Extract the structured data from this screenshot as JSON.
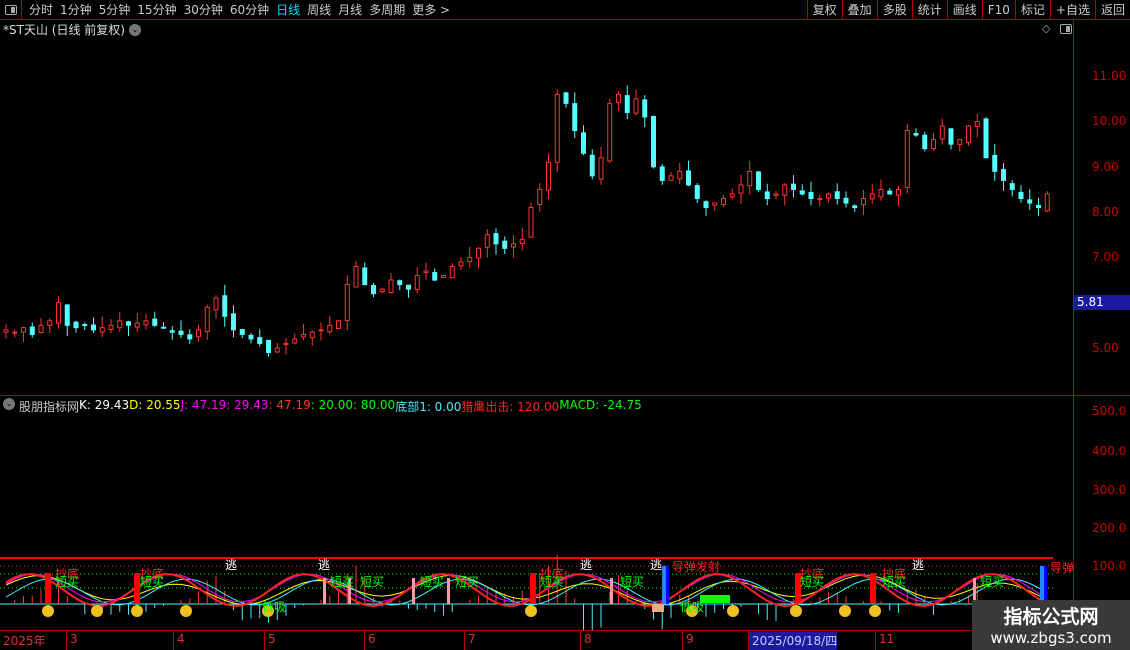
{
  "toolbar": {
    "periods": [
      "分时",
      "1分钟",
      "5分钟",
      "15分钟",
      "30分钟",
      "60分钟",
      "日线",
      "周线",
      "月线",
      "多周期",
      "更多 >"
    ],
    "active": "日线",
    "right_buttons": [
      "复权",
      "叠加",
      "多股",
      "统计",
      "画线",
      "F10",
      "标记",
      "+自选",
      "返回"
    ]
  },
  "stock": {
    "title": "*ST天山 (日线 前复权)"
  },
  "price_axis": {
    "labels": [
      "11.00",
      "10.00",
      "9.00",
      "8.00",
      "7.00",
      "5.00"
    ],
    "current": "5.81",
    "current_bg": "#1a1aa0"
  },
  "indicator": {
    "name": "股朋指标网",
    "k": "K: 29.43",
    "d": "D: 20.55",
    "j": "J: 47.19",
    "v1": ": 29.43",
    "v2": ": 47.19",
    "v3": ": 20.00",
    "v4": ": 80.00",
    "bottom": "底部1: 0.00",
    "eagle": "猎鹰出击: 120.00",
    "macd": "MACD: -24.75",
    "axis": [
      "500.0",
      "400.0",
      "300.0",
      "200.0",
      "100.0"
    ]
  },
  "signals": {
    "chaodi": "抄底",
    "duanmai": "短买",
    "tao": "逃",
    "dixi": "低吸",
    "daodan_fashe": "导弹发射",
    "daodan": "导弹"
  },
  "dates": [
    "2025年",
    "3",
    "4",
    "5",
    "6",
    "7",
    "8",
    "9",
    "2025/09/18/四",
    "11"
  ],
  "watermark": {
    "name": "指标公式网",
    "url": "www.zbgs3.com"
  },
  "chart_data": {
    "type": "candlestick",
    "ylim": [
      4.2,
      12
    ],
    "closes": [
      5.4,
      5.35,
      5.45,
      5.3,
      5.5,
      5.6,
      6.0,
      5.5,
      5.45,
      5.5,
      5.4,
      5.45,
      5.5,
      5.6,
      5.5,
      5.55,
      5.6,
      5.5,
      5.45,
      5.35,
      5.3,
      5.2,
      5.4,
      5.9,
      6.1,
      5.7,
      5.4,
      5.3,
      5.2,
      5.1,
      4.9,
      5.0,
      5.1,
      5.2,
      5.3,
      5.35,
      5.4,
      5.5,
      5.6,
      6.4,
      6.8,
      6.4,
      6.2,
      6.3,
      6.5,
      6.4,
      6.3,
      6.6,
      6.7,
      6.5,
      6.6,
      6.8,
      6.9,
      7.0,
      7.2,
      7.5,
      7.3,
      7.2,
      7.3,
      7.4,
      8.1,
      8.5,
      9.1,
      10.6,
      10.4,
      9.8,
      9.3,
      8.8,
      9.2,
      10.4,
      10.6,
      10.2,
      10.5,
      10.1,
      9.0,
      8.7,
      8.8,
      8.9,
      8.6,
      8.3,
      8.1,
      8.2,
      8.3,
      8.4,
      8.6,
      8.9,
      8.5,
      8.3,
      8.4,
      8.6,
      8.5,
      8.4,
      8.3,
      8.3,
      8.4,
      8.3,
      8.2,
      8.1,
      8.3,
      8.4,
      8.5,
      8.4,
      8.5,
      9.8,
      9.7,
      9.4,
      9.6,
      9.9,
      9.5,
      9.6,
      9.9,
      10.0,
      9.2,
      8.9,
      8.7,
      8.5,
      8.3,
      8.2,
      8.1,
      8.4
    ]
  }
}
